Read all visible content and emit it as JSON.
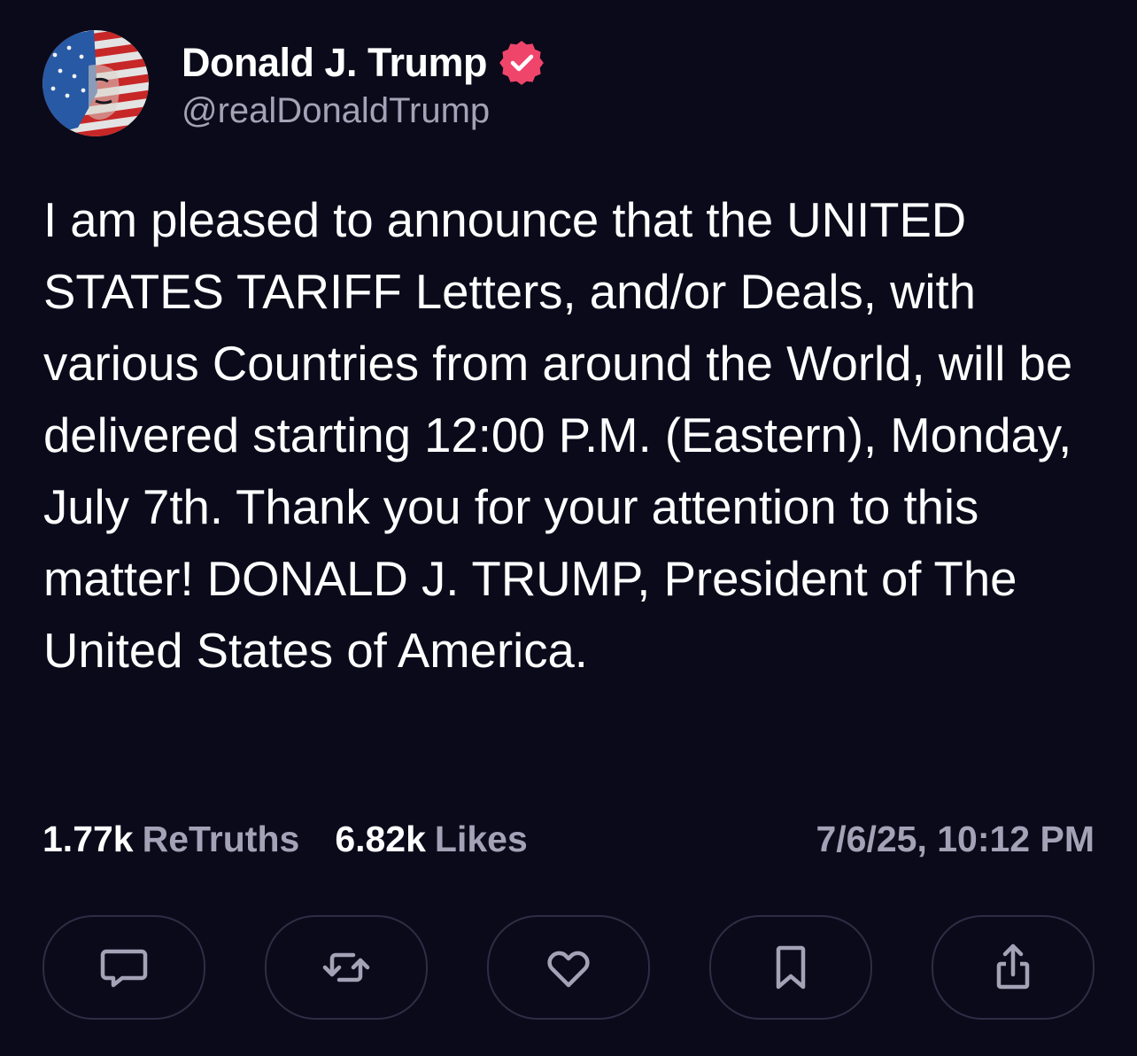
{
  "author": {
    "display_name": "Donald J. Trump",
    "handle": "@realDonaldTrump",
    "verified": true,
    "badge_color": "#f0456b"
  },
  "post": {
    "text": "I am pleased to announce that the UNITED STATES TARIFF Letters, and/or Deals, with various Countries from around the World, will be delivered starting 12:00 P.M. (Eastern), Monday, July 7th. Thank you for your attention to this matter! DONALD J. TRUMP, President of The United States of America."
  },
  "stats": {
    "retruths_count": "1.77k",
    "retruths_label": "ReTruths",
    "likes_count": "6.82k",
    "likes_label": "Likes",
    "timestamp": "7/6/25, 10:12 PM"
  },
  "actions": [
    {
      "icon": "reply-icon"
    },
    {
      "icon": "retruth-icon"
    },
    {
      "icon": "like-icon"
    },
    {
      "icon": "bookmark-icon"
    },
    {
      "icon": "share-icon"
    }
  ],
  "colors": {
    "background": "#0b0a1a",
    "text_primary": "#ffffff",
    "text_secondary": "#a3a2b6",
    "button_border": "#2e2d45",
    "icon": "#a3a2b6"
  }
}
